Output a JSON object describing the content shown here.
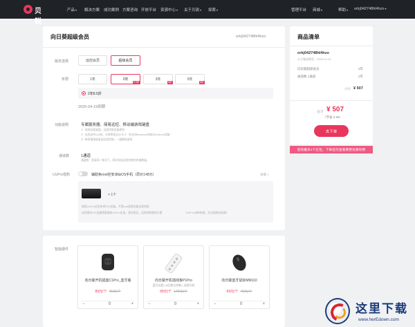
{
  "nav": {
    "logo_text": "贝锐",
    "items": [
      "产品",
      "解决方案",
      "成功案例",
      "方案咨询",
      "开放平台",
      "资源中心",
      "关于贝锐",
      "探索"
    ],
    "right_items": [
      "管理平台",
      "商城",
      "帮助"
    ],
    "account": "orkj042748hl4hzo"
  },
  "order": {
    "title": "向日葵超级会员",
    "account": "orkj042748hl4hzo",
    "version_label": "版本选择",
    "versions": [
      "远控会员",
      "超级会员"
    ],
    "period_label": "年限",
    "periods": [
      {
        "label": "1年",
        "badge": ""
      },
      {
        "label": "2年",
        "badge": "8.5折"
      },
      {
        "label": "3年",
        "badge": "8折"
      },
      {
        "label": "5年",
        "badge": "8折"
      }
    ],
    "selected_plan": "2年8.5折",
    "expire": "2025-04-19到期",
    "feature_label": "功能说明",
    "feature_title": "专属服务器、简易远控、移动端游戏键盘",
    "feature_lines": [
      "1）高效远程桌面，远程控制设备更快",
      "2）远程支持144帧，分辨率高达4K大小（仅支持windows和部分Android设备）",
      "3）畅享增强版桌面远程控制，一键解锁游戏"
    ],
    "channel_label": "通道数",
    "channel_value": "1通道",
    "channel_note": "通道数：登录同一帐号下，同时发起远程控制的终端数量。",
    "uupro_label": "UUPro借购",
    "uupro_text": "辅助免root控安卓&iOS手机（原价148元）",
    "uupro_right": "详情 >",
    "uupro_count": "1个",
    "uupro_notes": [
      "使用UUPro远控安卓/iOS设备，不需root权限也能远程控制",
      "远程操作iOS设备需要借助UUPro实现，现在购买，远程控制更加方便",
      "（UUPro自带电源，无法插移动电源）"
    ]
  },
  "cart": {
    "title": "商品清单",
    "account": "orkj042748hl4hzo",
    "sub": "公寸服务期至：2025-04-19",
    "rows": [
      {
        "label": "向日葵超级会员",
        "value": "2年"
      },
      {
        "label": "通道数 1通道",
        "value": "2年"
      }
    ],
    "subtotal_label": "小计",
    "subtotal": "¥ 507",
    "total_label": "合计",
    "total": "¥ 507",
    "saved": "（节省 ¥ 89）",
    "pay_button": "去下单",
    "banner": "您有最多1个红包，下单后可查看要更优惠利用"
  },
  "hardware": {
    "label": "智能硬件",
    "products": [
      {
        "name": "向日葵开机插座C1Pro_蓝牙版",
        "sub": "",
        "price": "89元/个",
        "orig": "75元/个",
        "qty": "0"
      },
      {
        "name": "向日葵开机插线板P1Pro",
        "sub": "蓝牙远程 | 8位独立控制 | 远程开机",
        "price": "99元/个",
        "orig": "149元/个",
        "qty": "0"
      },
      {
        "name": "向日葵蓝牙鼠标MM110",
        "sub": "",
        "price": "69元/个",
        "orig": "49元/个",
        "qty": "0"
      }
    ]
  },
  "watermark": {
    "title": "这里下载",
    "url": "www.herEdown.com"
  }
}
